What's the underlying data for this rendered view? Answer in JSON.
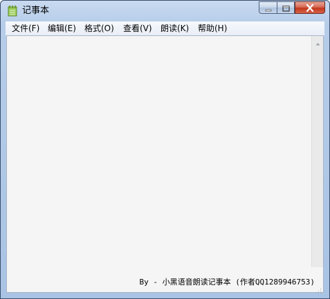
{
  "window": {
    "title": "记事本",
    "icon": "notepad-icon"
  },
  "caption_buttons": {
    "minimize": "minimize-icon",
    "maximize": "maximize-icon",
    "close": "close-icon"
  },
  "menu": {
    "file": "文件(F)",
    "edit": "编辑(E)",
    "format": "格式(O)",
    "view": "查看(V)",
    "read": "朗读(K)",
    "help": "帮助(H)"
  },
  "editor": {
    "content": ""
  },
  "status": {
    "text": "By - 小黑语音朗读记事本 (作者QQ1289946753)"
  },
  "colors": {
    "frame": "#a9c3e4",
    "close_button": "#c1371c",
    "editor_bg": "#f5f5f5"
  }
}
